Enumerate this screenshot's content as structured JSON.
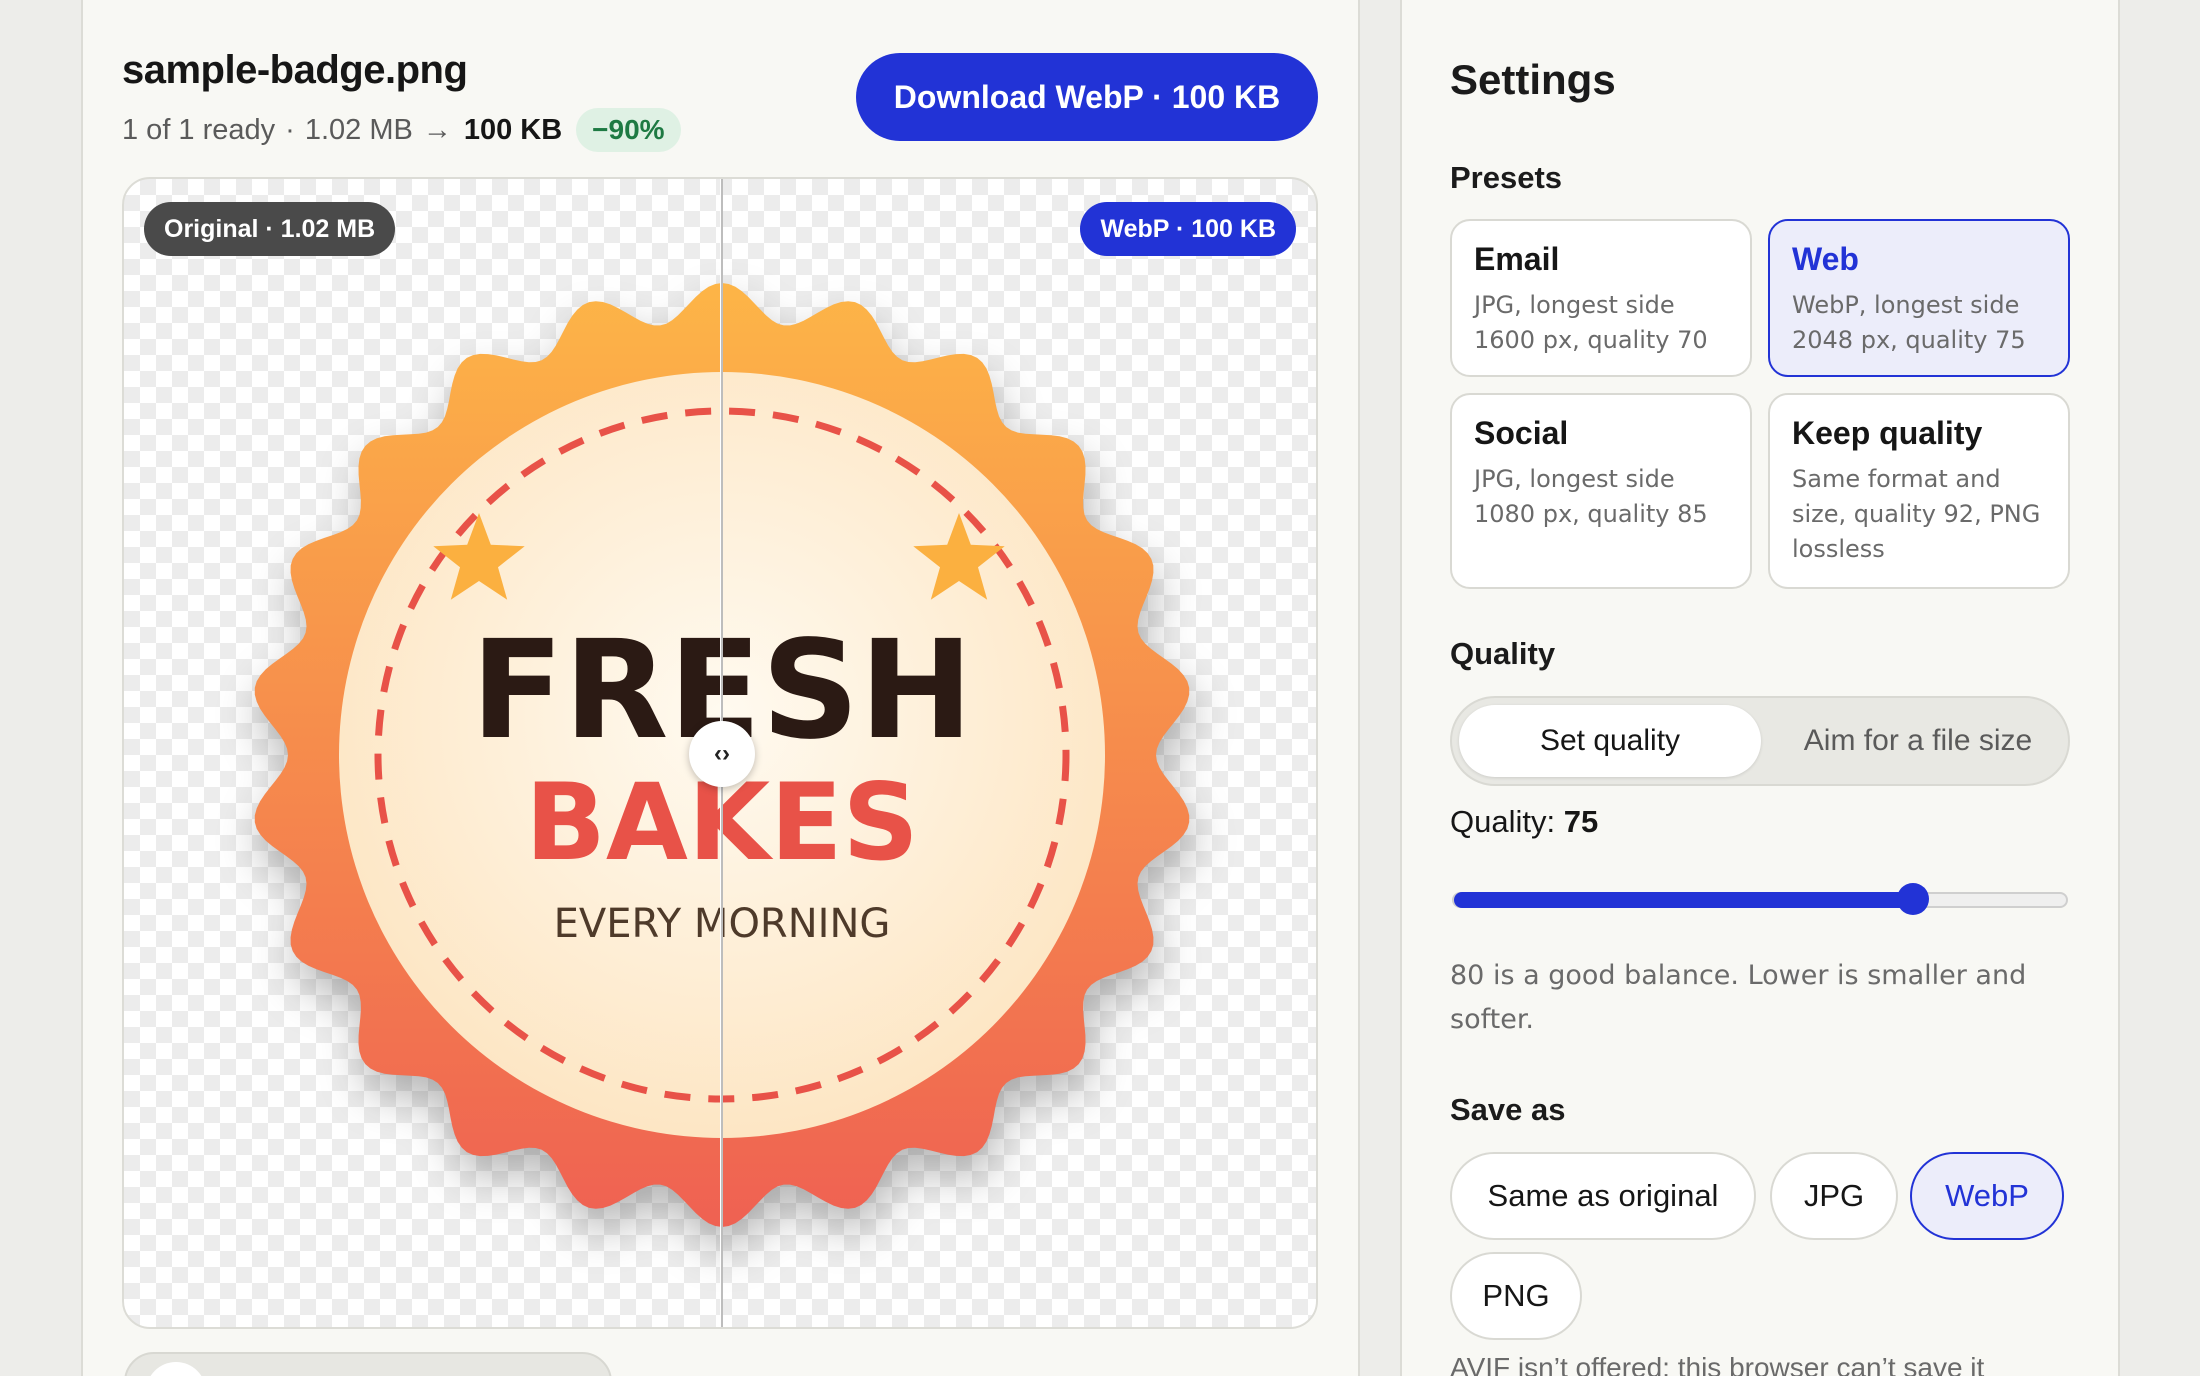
{
  "file": {
    "name": "sample-badge.png",
    "ready": "1 of 1 ready",
    "sep": "·",
    "original_size": "1.02 MB",
    "arrow": "→",
    "new_size": "100 KB",
    "saving": "−90%"
  },
  "download_button": "Download WebP · 100 KB",
  "viewer": {
    "original_tag": "Original · 1.02 MB",
    "webp_tag": "WebP · 100 KB",
    "handle_glyph": "‹›",
    "badge": {
      "line1": "FRESH",
      "line2": "BAKES",
      "line3": "EVERY MORNING",
      "color_outer_top": "#fdb547",
      "color_outer_bottom": "#ef6152",
      "color_inner": "#fde6c4",
      "color_text_dark": "#2b1a14",
      "color_text_red": "#e85248",
      "color_star": "#fbb040"
    }
  },
  "settings": {
    "title": "Settings",
    "presets_label": "Presets",
    "presets": [
      {
        "title": "Email",
        "desc": "JPG, longest side 1600 px, quality 70",
        "selected": false
      },
      {
        "title": "Web",
        "desc": "WebP, longest side 2048 px, quality 75",
        "selected": true
      },
      {
        "title": "Social",
        "desc": "JPG, longest side 1080 px, quality 85",
        "selected": false
      },
      {
        "title": "Keep quality",
        "desc": "Same format and size, quality 92, PNG lossless",
        "selected": false
      }
    ],
    "quality_label": "Quality",
    "mode_set": "Set quality",
    "mode_aim": "Aim for a file size",
    "quality_prefix": "Quality:",
    "quality_value": "75",
    "slider": {
      "min": 0,
      "max": 100,
      "value": 75
    },
    "hint": "80 is a good balance. Lower is smaller and softer.",
    "save_as_label": "Save as",
    "formats": [
      {
        "label": "Same as original",
        "selected": false
      },
      {
        "label": "JPG",
        "selected": false
      },
      {
        "label": "WebP",
        "selected": true
      },
      {
        "label": "PNG",
        "selected": false
      }
    ],
    "note": "AVIF isn’t offered; this browser can’t save it"
  },
  "accent_color": "#2233d6"
}
